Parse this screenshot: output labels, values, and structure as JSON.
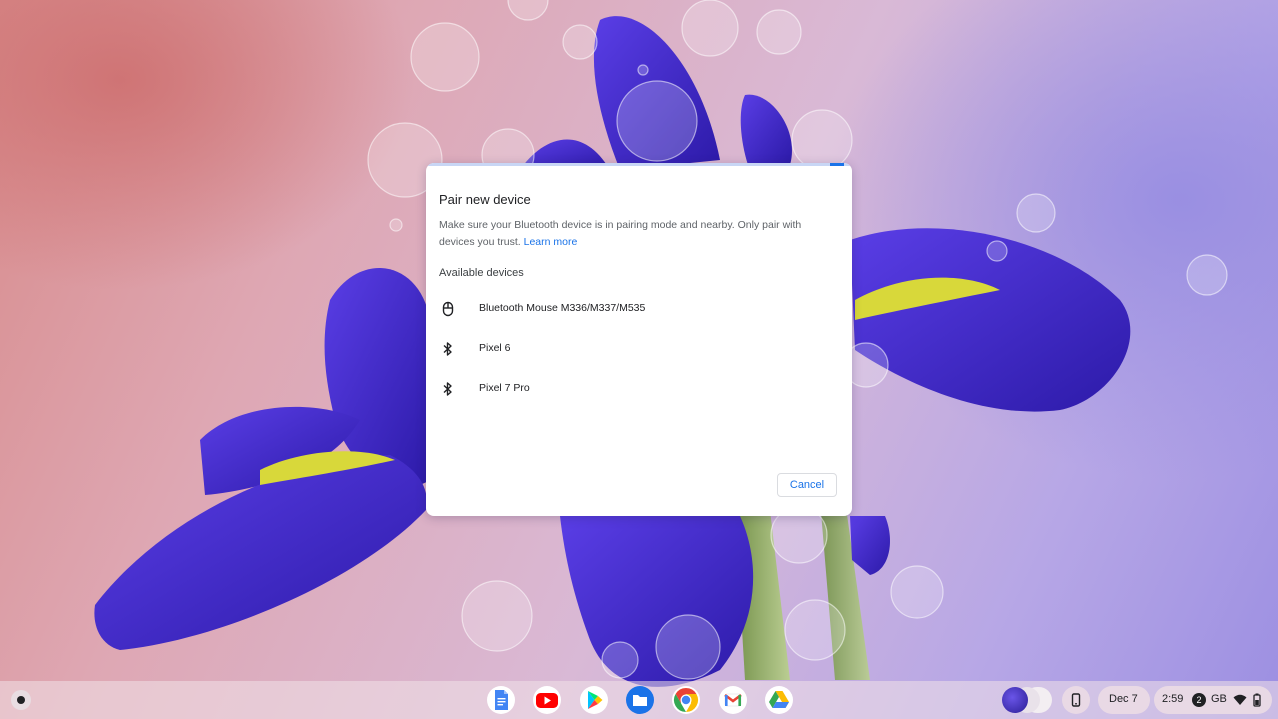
{
  "dialog": {
    "title": "Pair new device",
    "description": "Make sure your Bluetooth device is in pairing mode and nearby. Only pair with devices you trust.",
    "learn_more": "Learn more",
    "section_label": "Available devices",
    "devices": [
      {
        "name": "Bluetooth Mouse M336/M337/M535",
        "icon": "mouse-icon"
      },
      {
        "name": "Pixel 6",
        "icon": "bluetooth-icon"
      },
      {
        "name": "Pixel 7 Pro",
        "icon": "bluetooth-icon"
      }
    ],
    "cancel_label": "Cancel"
  },
  "shelf": {
    "apps": [
      "Google Docs",
      "YouTube",
      "Google Play Store",
      "Files",
      "Google Chrome",
      "Gmail",
      "Google Drive"
    ],
    "date": "Dec 7",
    "time": "2:59",
    "notification_count": "2",
    "storage_label": "GB"
  },
  "colors": {
    "accent": "#1a73e8",
    "dialog_bg": "#ffffff",
    "text_primary": "#202124",
    "text_secondary": "#5f6368"
  }
}
